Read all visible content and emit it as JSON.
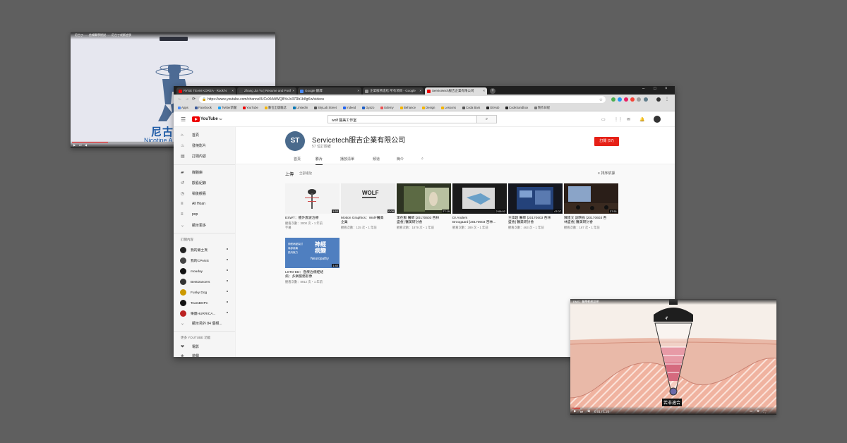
{
  "left_video": {
    "title": "尼古丁……依賴醫學總說……尼古丁戒斷症狀",
    "caption": "尼古丁",
    "subtitle": "Nicotine A"
  },
  "browser": {
    "tabs": [
      {
        "label": "RYSE TEAM KOREA - Rock'N",
        "color": "#e00"
      },
      {
        "label": "Zhang Jia Yu | Resume and Portf",
        "color": "#444"
      },
      {
        "label": "Google 翻譯",
        "color": "#4a8af4"
      },
      {
        "label": "企業服務連結 所有項目 - Google",
        "color": "#999"
      },
      {
        "label": "Servicetech服吉企業有限公司",
        "color": "#e00"
      }
    ],
    "url": "https://www.youtube.com/channel/UCoXkMiWQ8YeJo37Rb1b8gKw/videos",
    "bookmarks": [
      {
        "label": "Apps",
        "color": "#4a8af4"
      },
      {
        "label": "Facebook",
        "color": "#3b5998"
      },
      {
        "label": "Twitter新聞",
        "color": "#1da1f2"
      },
      {
        "label": "YouTube",
        "color": "#e00"
      },
      {
        "label": "數位出版雜誌",
        "color": "#f4b400"
      },
      {
        "label": "LinkedIn",
        "color": "#0077b5"
      },
      {
        "label": "SkyLab Street",
        "color": "#555"
      },
      {
        "label": "Indeed",
        "color": "#2164f3"
      },
      {
        "label": "Gyazo",
        "color": "#1d5ec7"
      },
      {
        "label": "Udemy",
        "color": "#ec5252"
      },
      {
        "label": "Behance",
        "color": "#f4b400"
      },
      {
        "label": "Design",
        "color": "#f4b400"
      },
      {
        "label": "Lessons",
        "color": "#f4b400"
      },
      {
        "label": "Coda Bars",
        "color": "#555"
      },
      {
        "label": "GitHub",
        "color": "#222"
      },
      {
        "label": "CodeSandbox",
        "color": "#222"
      },
      {
        "label": "製作日程",
        "color": "#777"
      }
    ]
  },
  "youtube": {
    "logo": "YouTube",
    "logo_region": "TW",
    "search_value": "wolf 醫美工作室",
    "sidebar": {
      "main": [
        "首頁",
        "發燒影片",
        "訂閱內容"
      ],
      "library": [
        "媒體庫",
        "觀看紀錄",
        "稍後觀看",
        "All Hoan",
        "pop",
        "顯示更多"
      ],
      "subs_header": "訂閱內容",
      "subs": [
        {
          "label": "我的第士頁",
          "color": "#222"
        },
        {
          "label": "我的CPANS",
          "color": "#444"
        },
        {
          "label": "mouday",
          "color": "#111"
        },
        {
          "label": "BestDancers",
          "color": "#333"
        },
        {
          "label": "Funky Dog",
          "color": "#c90"
        },
        {
          "label": "TeamBOPn",
          "color": "#111"
        },
        {
          "label": "樂團HURRICA...",
          "color": "#b22"
        }
      ],
      "subs_more": "顯示另外 84 個頻...",
      "more_header": "更多 YOUTUBE 功能",
      "more": [
        "電影",
        "遊戲"
      ]
    },
    "channel": {
      "avatar_text": "ST",
      "name": "Servicetech服吉企業有限公司",
      "subscribers": "57 位訂閱者",
      "subscribe_label": "訂閱 (57)",
      "tabs": [
        "首頁",
        "影片",
        "播放清單",
        "頻道",
        "簡介"
      ],
      "section_title": "上傳",
      "section_sub": "全部播放",
      "sort_label": "排序依據"
    },
    "videos": [
      {
        "title": "ESWT：體外震波治療",
        "meta": "觀看次數：3000 次・1 年前\n字幕",
        "duration": "1:53"
      },
      {
        "title": "Motion Graphics：WolF醫美\n企業",
        "meta": "觀看次數：125 次・1 年前",
        "duration": "0:08"
      },
      {
        "title": "李在勳 醫師 [20170603 杏林\n盛會] 醫美研討會",
        "meta": "觀看次數：1879 次・1 年前",
        "duration": "27:19"
      },
      {
        "title": "Dr.Anders\nBroogaard [20170603 杏林...",
        "meta": "觀看次數：289 次・1 年前",
        "duration": "2:06:02"
      },
      {
        "title": "王偉超 醫師 [20170603 杏林\n盛會] 醫美研討會",
        "meta": "觀看次數：463 次・1 年前",
        "duration": "47:07"
      },
      {
        "title": "陳建文 副院長 [20170603 杏\n林盛會] 醫美研討會",
        "meta": "觀看次數：167 次・1 年前",
        "duration": "37:51"
      },
      {
        "title": "LSTD-ED：音療治療經絡\n病：多樂服務影像",
        "meta": "觀看次數：8912 次・1 年前",
        "duration": "1:40"
      }
    ],
    "neuro_thumb": {
      "left": [
        "神經病變探討",
        "局部疼痛",
        "肌肉無力"
      ],
      "big": "神經\n病變",
      "en": "Neuropathy"
    }
  },
  "right_video": {
    "title": "EMS：醫學動態說明",
    "brand": "ㄔ",
    "caption": "若非適合",
    "time": "0:01 / 1:20"
  }
}
